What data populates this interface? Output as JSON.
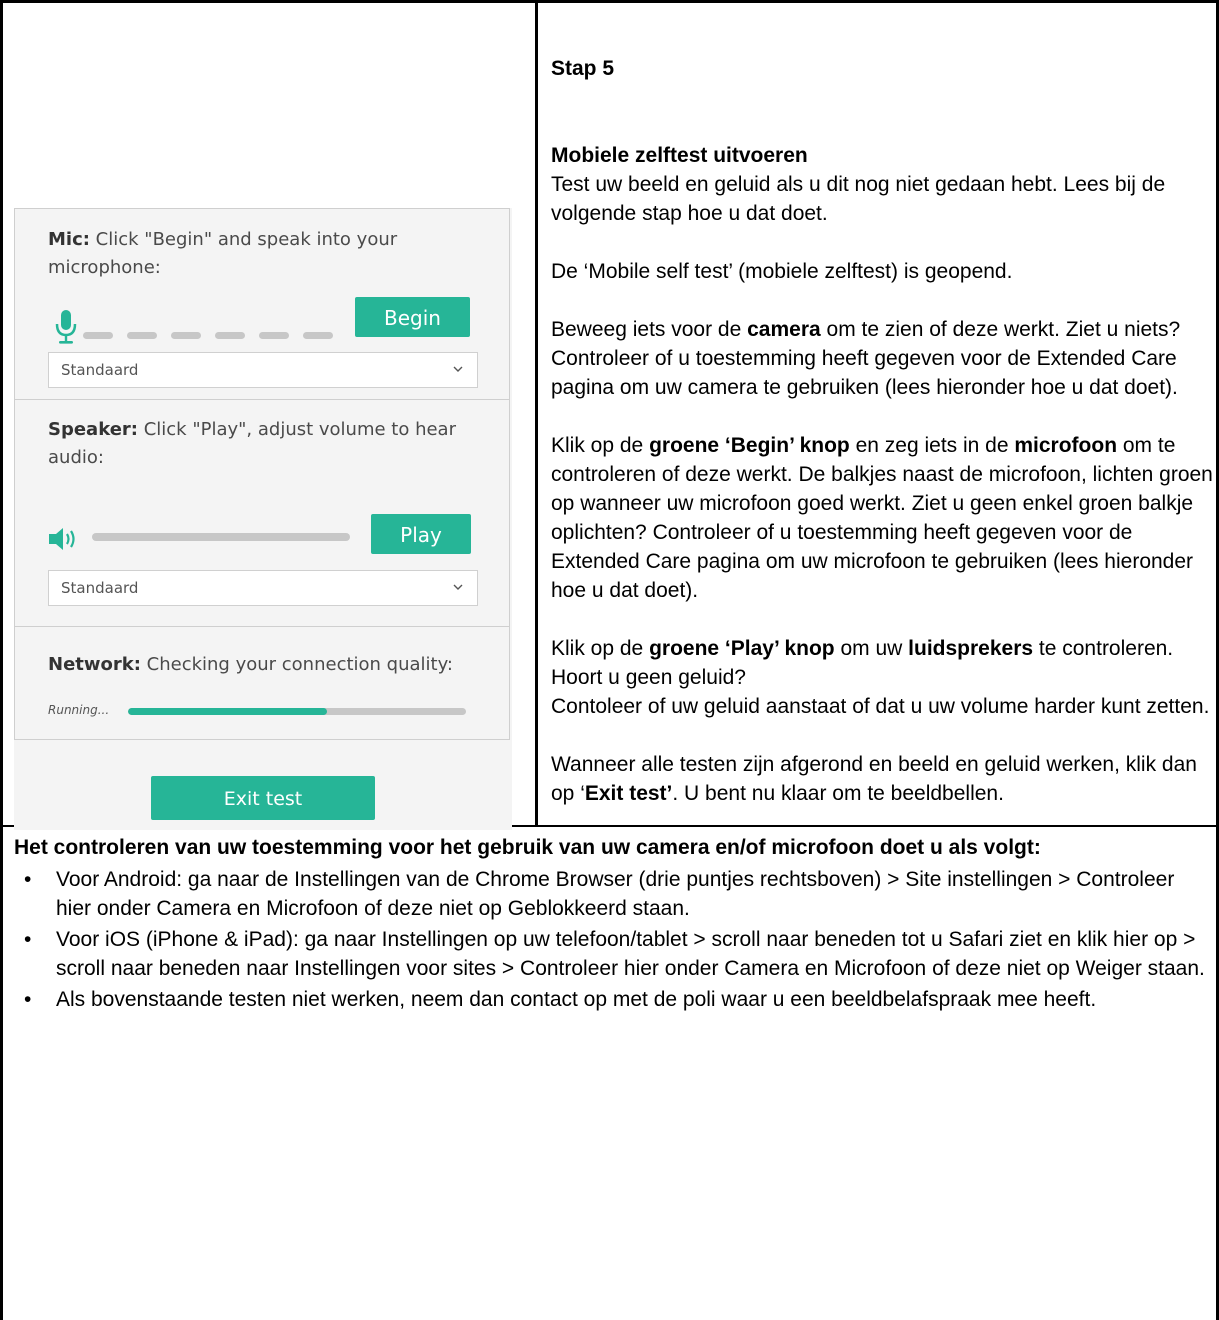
{
  "mic": {
    "label_bold": "Mic:",
    "label_rest": " Click \"Begin\" and speak into your microphone:",
    "begin_label": "Begin",
    "device": "Standaard",
    "level_bars_active": 0,
    "level_bars_total": 6
  },
  "speaker": {
    "label_bold": "Speaker:",
    "label_rest": " Click \"Play\", adjust volume to hear audio:",
    "play_label": "Play",
    "device": "Standaard"
  },
  "network": {
    "label_bold": "Network:",
    "label_rest": " Checking your connection quality:",
    "status": "Running...",
    "progress_percent": 59
  },
  "exit_label": "Exit test",
  "colors": {
    "accent": "#26b597",
    "inactive": "#c7c7c7"
  },
  "step": {
    "title": "Stap 5",
    "heading": "Mobiele zelftest uitvoeren",
    "p1": "Test uw beeld en geluid als u dit nog niet gedaan hebt. Lees bij de volgende stap hoe u dat doet.",
    "p2": "De ‘Mobile self test’ (mobiele zelftest) is geopend.",
    "p3_a": "Beweeg iets voor de ",
    "p3_b": "camera",
    "p3_c": " om te zien of deze werkt. Ziet u niets? Controleer of u toestemming heeft gegeven voor de Extended Care pagina om uw camera te gebruiken (lees hieronder hoe u dat doet).",
    "p4_a": "Klik op de ",
    "p4_b": "groene ‘Begin’ knop",
    "p4_c": " en zeg iets in de ",
    "p4_d": "microfoon",
    "p4_e": " om te controleren of deze werkt. De balkjes naast de microfoon, lichten groen op wanneer uw microfoon goed werkt. Ziet u geen enkel groen balkje oplichten? Controleer of u toestemming heeft gegeven voor de Extended Care pagina om uw microfoon te gebruiken (lees hieronder hoe u dat doet).",
    "p5_a": "Klik op de ",
    "p5_b": "groene ‘Play’ knop",
    "p5_c": " om uw ",
    "p5_d": "luidsprekers",
    "p5_e": " te controleren. Hoort u geen geluid?",
    "p5_f": "Contoleer of uw geluid aanstaat of dat u uw volume harder kunt zetten.",
    "p6_a": "Wanneer alle testen zijn afgerond en beeld en geluid werken, klik dan op ‘",
    "p6_b": "Exit test’",
    "p6_c": ". U bent nu klaar om te beeldbellen."
  },
  "permissions": {
    "title": "Het controleren van uw toestemming voor het gebruik van uw camera en/of microfoon doet u als volgt:",
    "bullet_char": "•",
    "items": [
      "Voor Android: ga naar de Instellingen van de Chrome Browser (drie puntjes rechtsboven) > Site instellingen > Controleer hier onder Camera en Microfoon of deze niet op Geblokkeerd staan.",
      "Voor iOS (iPhone & iPad): ga naar Instellingen op uw telefoon/tablet > scroll naar beneden tot u Safari ziet en klik hier op > scroll naar beneden naar Instellingen voor sites > Controleer hier onder Camera en Microfoon of deze niet op Weiger staan.",
      "Als bovenstaande testen niet werken, neem dan contact op met de poli waar u een beeldbelafspraak mee heeft."
    ]
  }
}
